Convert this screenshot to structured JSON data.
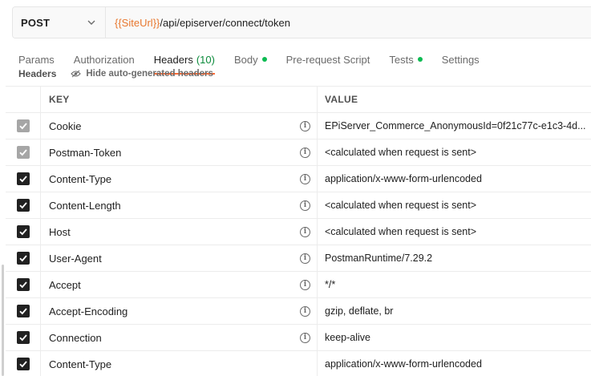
{
  "request": {
    "method": "POST",
    "url_variable": "{{SiteUrl}}",
    "url_path": "/api/episerver/connect/token"
  },
  "tabs": [
    {
      "label": "Params",
      "active": false
    },
    {
      "label": "Authorization",
      "active": false
    },
    {
      "label": "Headers",
      "count": "(10)",
      "active": true
    },
    {
      "label": "Body",
      "dot": true,
      "active": false
    },
    {
      "label": "Pre-request Script",
      "active": false
    },
    {
      "label": "Tests",
      "dot": true,
      "active": false
    },
    {
      "label": "Settings",
      "active": false
    }
  ],
  "subheader": {
    "label": "Headers",
    "hide_auto_label": "Hide auto-generated headers"
  },
  "table": {
    "columns": {
      "key": "KEY",
      "value": "VALUE"
    },
    "rows": [
      {
        "key": "Cookie",
        "value": "EPiServer_Commerce_AnonymousId=0f21c77c-e1c3-4d...",
        "checked": true,
        "disabled": true,
        "info": true
      },
      {
        "key": "Postman-Token",
        "value": "<calculated when request is sent>",
        "checked": true,
        "disabled": true,
        "info": true
      },
      {
        "key": "Content-Type",
        "value": "application/x-www-form-urlencoded",
        "checked": true,
        "disabled": false,
        "info": true
      },
      {
        "key": "Content-Length",
        "value": "<calculated when request is sent>",
        "checked": true,
        "disabled": false,
        "info": true
      },
      {
        "key": "Host",
        "value": "<calculated when request is sent>",
        "checked": true,
        "disabled": false,
        "info": true
      },
      {
        "key": "User-Agent",
        "value": "PostmanRuntime/7.29.2",
        "checked": true,
        "disabled": false,
        "info": true
      },
      {
        "key": "Accept",
        "value": "*/*",
        "checked": true,
        "disabled": false,
        "info": true
      },
      {
        "key": "Accept-Encoding",
        "value": "gzip, deflate, br",
        "checked": true,
        "disabled": false,
        "info": true
      },
      {
        "key": "Connection",
        "value": "keep-alive",
        "checked": true,
        "disabled": false,
        "info": true
      },
      {
        "key": "Content-Type",
        "value": "application/x-www-form-urlencoded",
        "checked": true,
        "disabled": false,
        "info": false
      }
    ]
  },
  "colors": {
    "accent": "#ff6c37",
    "variable": "#e8772e",
    "status_dot": "#0cbb52",
    "checkbox": "#212121",
    "checkbox_disabled": "#a6a6a6"
  }
}
